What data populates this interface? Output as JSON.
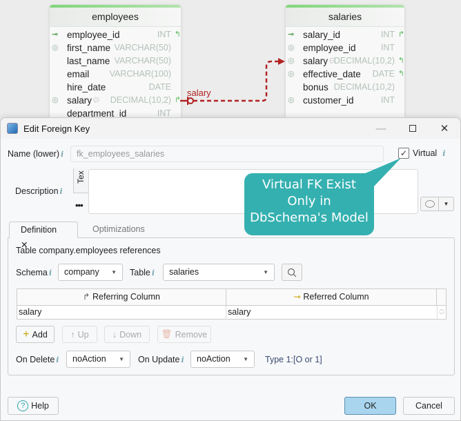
{
  "diagram": {
    "tables": [
      {
        "name": "employees",
        "columns": [
          {
            "icon": "primary-key-icon",
            "name": "employee_id",
            "type": "INT",
            "arrow": "fk-in-arrow",
            "comment": false
          },
          {
            "icon": "index-icon",
            "name": "first_name",
            "type": "VARCHAR(50)",
            "arrow": "",
            "comment": false
          },
          {
            "icon": "",
            "name": "last_name",
            "type": "VARCHAR(50)",
            "arrow": "",
            "comment": false
          },
          {
            "icon": "",
            "name": "email",
            "type": "VARCHAR(100)",
            "arrow": "",
            "comment": false
          },
          {
            "icon": "",
            "name": "hire_date",
            "type": "DATE",
            "arrow": "",
            "comment": false
          },
          {
            "icon": "index-icon",
            "name": "salary",
            "type": "DECIMAL(10,2)",
            "arrow": "fk-out-arrow",
            "comment": true
          },
          {
            "icon": "",
            "name": "department_id",
            "type": "INT",
            "arrow": "",
            "comment": false
          }
        ]
      },
      {
        "name": "salaries",
        "columns": [
          {
            "icon": "primary-key-icon",
            "name": "salary_id",
            "type": "INT",
            "arrow": "fk-out-arrow",
            "comment": false
          },
          {
            "icon": "index-icon",
            "name": "employee_id",
            "type": "INT",
            "arrow": "",
            "comment": false
          },
          {
            "icon": "index-icon",
            "name": "salary",
            "type": "DECIMAL(10,2)",
            "arrow": "fk-in-arrow",
            "comment": true
          },
          {
            "icon": "index-icon",
            "name": "effective_date",
            "type": "DATE",
            "arrow": "fk-in-arrow",
            "comment": false
          },
          {
            "icon": "",
            "name": "bonus",
            "type": "DECIMAL(10,2)",
            "arrow": "",
            "comment": false
          },
          {
            "icon": "index-icon",
            "name": "customer_id",
            "type": "INT",
            "arrow": "",
            "comment": false
          }
        ]
      }
    ],
    "relation_label": "salary",
    "relation_color": "#b22222"
  },
  "dialog": {
    "title": "Edit Foreign Key",
    "name_label": "Name (lower)",
    "name_value": "fk_employees_salaries",
    "virtual_label": "Virtual",
    "virtual_checked": true,
    "description_label": "Description",
    "description_tab": "Tex",
    "description_value": "",
    "more_label": "•••",
    "callout": [
      "Virtual FK Exist",
      "Only in",
      "DbSchema's Model"
    ],
    "callout_color": "#35b0b0",
    "tabs": [
      {
        "label": "Definition ✕",
        "active": true
      },
      {
        "label": "Optimizations",
        "active": false
      }
    ],
    "references_text": "Table company.employees references",
    "schema_label": "Schema",
    "schema_value": "company",
    "table_label": "Table",
    "table_value": "salaries",
    "grid": {
      "headers": [
        "Referring Column",
        "Referred Column"
      ],
      "rows": [
        [
          "salary",
          "salary"
        ]
      ]
    },
    "buttons": {
      "add": "Add",
      "up": "Up",
      "down": "Down",
      "remove": "Remove",
      "help": "Help",
      "ok": "OK",
      "cancel": "Cancel"
    },
    "on_delete_label": "On Delete",
    "on_delete_value": "noAction",
    "on_update_label": "On Update",
    "on_update_value": "noAction",
    "type_text": "Type 1:[O or 1]",
    "info_glyph": "i"
  }
}
